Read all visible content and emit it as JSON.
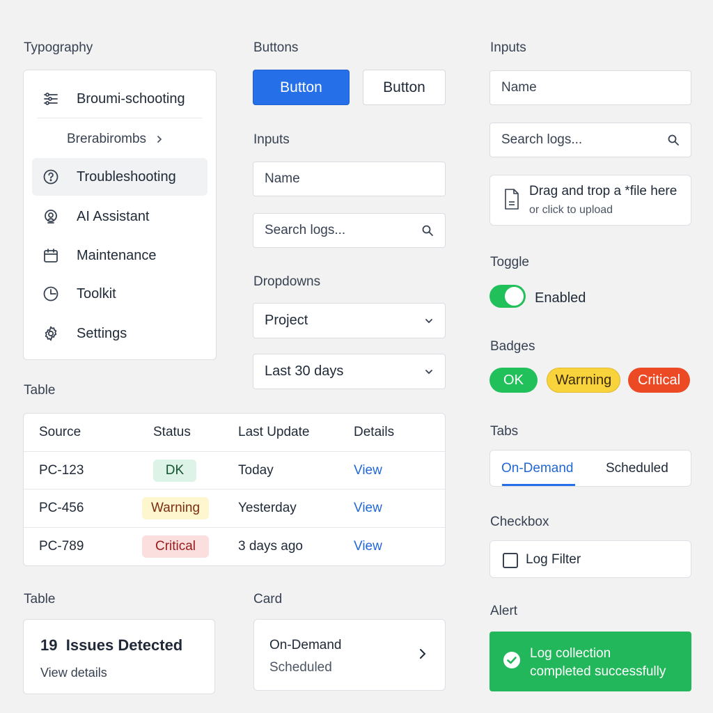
{
  "sections": {
    "typography": "Typography",
    "buttons": "Buttons",
    "inputs_mid": "Inputs",
    "inputs_right": "Inputs",
    "dropdowns": "Dropdowns",
    "table": "Table",
    "table2": "Table",
    "card": "Card",
    "toggle": "Toggle",
    "badges": "Badges",
    "tabs": "Tabs",
    "checkbox": "Checkbox",
    "alert": "Alert"
  },
  "sidebar": {
    "items": [
      {
        "label": "Broumi-schooting",
        "icon": "sliders-icon"
      },
      {
        "label": "Brerabirombs",
        "icon": "chevron-right-icon"
      },
      {
        "label": "Troubleshooting",
        "icon": "help-circle-icon",
        "active": true
      },
      {
        "label": "AI Assistant",
        "icon": "assistant-icon"
      },
      {
        "label": "Maintenance",
        "icon": "calendar-icon"
      },
      {
        "label": "Toolkit",
        "icon": "gauge-icon"
      },
      {
        "label": "Settings",
        "icon": "gear-icon"
      }
    ]
  },
  "buttons": {
    "primary_label": "Button",
    "secondary_label": "Button",
    "primary_color": "#2570e8"
  },
  "inputs_mid": {
    "name_placeholder": "Name",
    "search_placeholder": "Search logs..."
  },
  "dropdowns": {
    "project": "Project",
    "range": "Last 30 days"
  },
  "table": {
    "headers": [
      "Source",
      "Status",
      "Last Update",
      "Details"
    ],
    "rows": [
      {
        "source": "PC-123",
        "status": "DK",
        "updated": "Today",
        "details": "View"
      },
      {
        "source": "PC-456",
        "status": "Warning",
        "updated": "Yesterday",
        "details": "View"
      },
      {
        "source": "PC-789",
        "status": "Critical",
        "updated": "3 days ago",
        "details": "View"
      }
    ]
  },
  "issues_card": {
    "count": "19",
    "title": "Issues Detected",
    "link": "View details"
  },
  "card": {
    "title": "On-Demand",
    "subtitle": "Scheduled"
  },
  "inputs_right": {
    "name_placeholder": "Name",
    "search_placeholder": "Search logs...",
    "upload_title": "Drag and trop a *file here",
    "upload_sub": "or click to upload"
  },
  "toggle": {
    "label": "Enabled",
    "on": true,
    "color": "#22c05b"
  },
  "badges": {
    "ok": "OK",
    "warning": "Warrning",
    "critical": "Critical"
  },
  "tabs": {
    "items": [
      "On-Demand",
      "Scheduled"
    ],
    "active": "On-Demand"
  },
  "checkbox": {
    "label": "Log Filter",
    "checked": false
  },
  "alert": {
    "line1": "Log collection",
    "line2": "completed successfully",
    "color": "#22b75a"
  }
}
